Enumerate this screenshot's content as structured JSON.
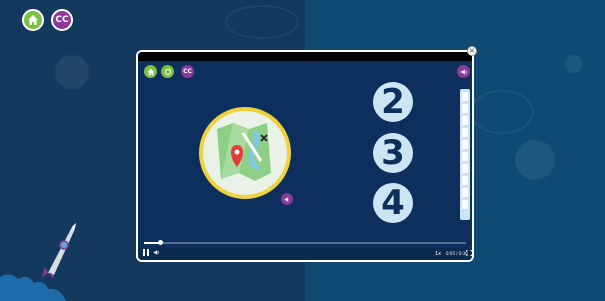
{
  "top_buttons": {
    "home_icon": "home-icon",
    "cc_label": "CC"
  },
  "modal": {
    "close_glyph": "×",
    "mini_controls": {
      "home_icon": "home-icon",
      "reload_icon": "reload-icon",
      "cc_label": "CC",
      "sound_icon": "speaker-icon"
    },
    "numbers": [
      "2",
      "3",
      "4"
    ],
    "map_icon": "map-icon",
    "video": {
      "progress": 0.05,
      "time_text": "0:05 / 0:36",
      "speed_text": "1x",
      "play_icon": "pause-icon",
      "volume_icon": "volume-icon",
      "fullscreen_icon": "fullscreen-icon"
    }
  },
  "colors": {
    "green": "#7cc242",
    "purple": "#8a3a9a",
    "navy": "#0c2f5d",
    "yellow": "#f1d23e",
    "light_blue": "#cbe6f2"
  }
}
